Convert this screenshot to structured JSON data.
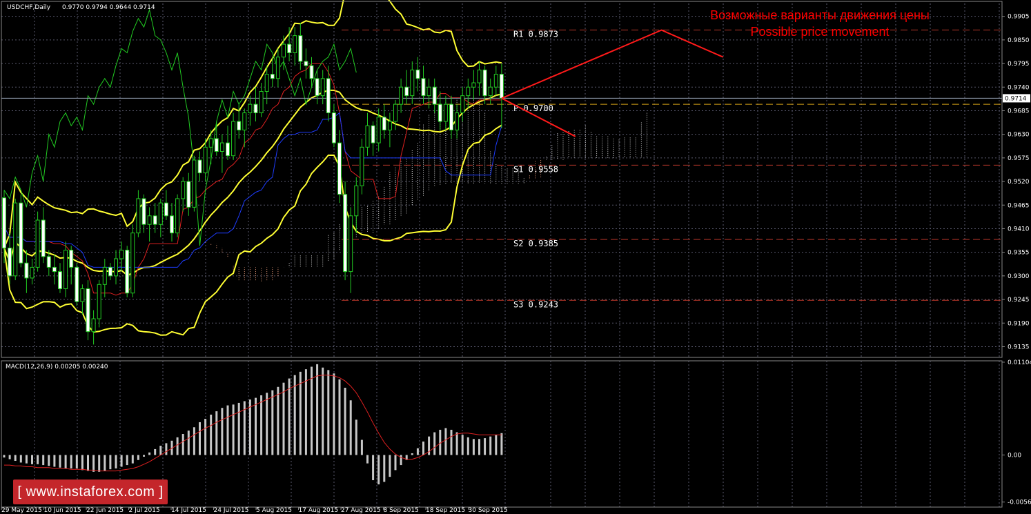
{
  "chart_data": [
    {
      "type": "candlestick",
      "title": "USDCHF,Daily",
      "ohlc_header": "0.9770 0.9794 0.9644 0.9714",
      "last_price": "0.9714",
      "ylim": [
        0.911,
        0.9935
      ],
      "price_ticks": [
        "0.9905",
        "0.9850",
        "0.9795",
        "0.9740",
        "0.9685",
        "0.9630",
        "0.9575",
        "0.9520",
        "0.9465",
        "0.9410",
        "0.9355",
        "0.9300",
        "0.9245",
        "0.9190",
        "0.9135"
      ],
      "date_labels": [
        "29 May 2015",
        "10 Jun 2015",
        "22 Jun 2015",
        "2 Jul 2015",
        "14 Jul 2015",
        "24 Jul 2015",
        "5 Aug 2015",
        "17 Aug 2015",
        "27 Aug 2015",
        "8 Sep 2015",
        "18 Sep 2015",
        "30 Sep 2015"
      ],
      "grid": true,
      "levels": [
        {
          "label": "R1 0.9873",
          "value": 0.9873,
          "color": "#c0392b"
        },
        {
          "label": "P 0.9700",
          "value": 0.97,
          "color": "#d4a017"
        },
        {
          "label": "S1 0.9558",
          "value": 0.9558,
          "color": "#c0392b"
        },
        {
          "label": "S2 0.9385",
          "value": 0.9385,
          "color": "#c0392b"
        },
        {
          "label": "S3 0.9243",
          "value": 0.9243,
          "color": "#c0392b"
        }
      ],
      "annotation_ru": "Возможные варианты движения цены",
      "annotation_en": "Possible price movement",
      "scenario_up": [
        [
          0.9714,
          0
        ],
        [
          0.9873,
          13
        ],
        [
          0.981,
          18
        ]
      ],
      "scenario_down": [
        [
          0.9714,
          0
        ],
        [
          0.9625,
          6
        ]
      ],
      "candles": [
        [
          0.9482,
          0.95,
          0.933,
          0.9365
        ],
        [
          0.9365,
          0.94,
          0.928,
          0.93
        ],
        [
          0.93,
          0.948,
          0.929,
          0.947
        ],
        [
          0.947,
          0.949,
          0.932,
          0.933
        ],
        [
          0.933,
          0.936,
          0.926,
          0.9295
        ],
        [
          0.9295,
          0.934,
          0.928,
          0.932
        ],
        [
          0.932,
          0.945,
          0.931,
          0.943
        ],
        [
          0.943,
          0.946,
          0.933,
          0.9345
        ],
        [
          0.9345,
          0.936,
          0.93,
          0.932
        ],
        [
          0.932,
          0.935,
          0.928,
          0.931
        ],
        [
          0.931,
          0.933,
          0.926,
          0.927
        ],
        [
          0.927,
          0.938,
          0.925,
          0.936
        ],
        [
          0.936,
          0.937,
          0.928,
          0.932
        ],
        [
          0.932,
          0.933,
          0.923,
          0.924
        ],
        [
          0.924,
          0.928,
          0.921,
          0.927
        ],
        [
          0.927,
          0.929,
          0.915,
          0.917
        ],
        [
          0.917,
          0.922,
          0.914,
          0.92
        ],
        [
          0.92,
          0.929,
          0.918,
          0.928
        ],
        [
          0.928,
          0.934,
          0.925,
          0.932
        ],
        [
          0.932,
          0.933,
          0.929,
          0.93
        ],
        [
          0.93,
          0.936,
          0.928,
          0.934
        ],
        [
          0.934,
          0.938,
          0.931,
          0.936
        ],
        [
          0.936,
          0.937,
          0.925,
          0.926
        ],
        [
          0.926,
          0.942,
          0.925,
          0.94
        ],
        [
          0.94,
          0.95,
          0.939,
          0.948
        ],
        [
          0.948,
          0.949,
          0.94,
          0.942
        ],
        [
          0.942,
          0.946,
          0.938,
          0.944
        ],
        [
          0.944,
          0.947,
          0.94,
          0.942
        ],
        [
          0.942,
          0.948,
          0.939,
          0.947
        ],
        [
          0.947,
          0.95,
          0.943,
          0.944
        ],
        [
          0.944,
          0.947,
          0.938,
          0.94
        ],
        [
          0.94,
          0.949,
          0.939,
          0.948
        ],
        [
          0.948,
          0.953,
          0.945,
          0.952
        ],
        [
          0.952,
          0.954,
          0.944,
          0.946
        ],
        [
          0.946,
          0.958,
          0.945,
          0.957
        ],
        [
          0.957,
          0.959,
          0.952,
          0.954
        ],
        [
          0.954,
          0.962,
          0.952,
          0.96
        ],
        [
          0.96,
          0.964,
          0.956,
          0.962
        ],
        [
          0.962,
          0.966,
          0.958,
          0.959
        ],
        [
          0.959,
          0.963,
          0.954,
          0.961
        ],
        [
          0.961,
          0.965,
          0.957,
          0.958
        ],
        [
          0.958,
          0.968,
          0.957,
          0.966
        ],
        [
          0.966,
          0.97,
          0.962,
          0.964
        ],
        [
          0.964,
          0.969,
          0.96,
          0.968
        ],
        [
          0.968,
          0.972,
          0.965,
          0.97
        ],
        [
          0.97,
          0.974,
          0.966,
          0.968
        ],
        [
          0.968,
          0.975,
          0.967,
          0.973
        ],
        [
          0.973,
          0.979,
          0.97,
          0.977
        ],
        [
          0.977,
          0.981,
          0.974,
          0.976
        ],
        [
          0.976,
          0.983,
          0.974,
          0.981
        ],
        [
          0.981,
          0.986,
          0.978,
          0.984
        ],
        [
          0.984,
          0.988,
          0.98,
          0.982
        ],
        [
          0.982,
          0.988,
          0.979,
          0.986
        ],
        [
          0.986,
          0.989,
          0.978,
          0.98
        ],
        [
          0.98,
          0.983,
          0.976,
          0.979
        ],
        [
          0.979,
          0.981,
          0.974,
          0.976
        ],
        [
          0.976,
          0.978,
          0.97,
          0.972
        ],
        [
          0.972,
          0.978,
          0.97,
          0.976
        ],
        [
          0.976,
          0.979,
          0.966,
          0.968
        ],
        [
          0.968,
          0.97,
          0.96,
          0.961
        ],
        [
          0.961,
          0.964,
          0.947,
          0.949
        ],
        [
          0.949,
          0.952,
          0.929,
          0.931
        ],
        [
          0.931,
          0.946,
          0.926,
          0.944
        ],
        [
          0.944,
          0.953,
          0.94,
          0.951
        ],
        [
          0.951,
          0.962,
          0.949,
          0.96
        ],
        [
          0.96,
          0.968,
          0.958,
          0.965
        ],
        [
          0.965,
          0.966,
          0.958,
          0.961
        ],
        [
          0.961,
          0.969,
          0.959,
          0.967
        ],
        [
          0.967,
          0.97,
          0.962,
          0.964
        ],
        [
          0.964,
          0.968,
          0.96,
          0.966
        ],
        [
          0.966,
          0.971,
          0.964,
          0.97
        ],
        [
          0.97,
          0.976,
          0.968,
          0.974
        ],
        [
          0.974,
          0.978,
          0.97,
          0.972
        ],
        [
          0.972,
          0.98,
          0.97,
          0.978
        ],
        [
          0.978,
          0.981,
          0.973,
          0.976
        ],
        [
          0.976,
          0.979,
          0.97,
          0.972
        ],
        [
          0.972,
          0.976,
          0.969,
          0.974
        ],
        [
          0.974,
          0.976,
          0.968,
          0.97
        ],
        [
          0.97,
          0.973,
          0.964,
          0.966
        ],
        [
          0.966,
          0.972,
          0.964,
          0.97
        ],
        [
          0.97,
          0.972,
          0.962,
          0.964
        ],
        [
          0.964,
          0.97,
          0.962,
          0.968
        ],
        [
          0.968,
          0.974,
          0.966,
          0.972
        ],
        [
          0.972,
          0.976,
          0.969,
          0.974
        ],
        [
          0.974,
          0.978,
          0.971,
          0.975
        ],
        [
          0.975,
          0.98,
          0.972,
          0.978
        ],
        [
          0.978,
          0.979,
          0.97,
          0.972
        ],
        [
          0.972,
          0.976,
          0.97,
          0.974
        ],
        [
          0.974,
          0.979,
          0.972,
          0.977
        ],
        [
          0.977,
          0.9794,
          0.9644,
          0.9714
        ]
      ]
    },
    {
      "type": "bar",
      "title": "MACD(12,26,9) 0.00205 0.00240",
      "ylim": [
        -0.0062,
        0.0112
      ],
      "ticks": [
        "0.01104",
        "0.00",
        "-0.0056"
      ],
      "histogram": [
        -0.0003,
        -0.0005,
        -0.0007,
        -0.0009,
        -0.001,
        -0.0011,
        -0.0011,
        -0.0012,
        -0.0013,
        -0.0014,
        -0.0015,
        -0.0016,
        -0.0016,
        -0.0016,
        -0.0018,
        -0.0019,
        -0.002,
        -0.002,
        -0.0019,
        -0.0017,
        -0.0016,
        -0.0014,
        -0.0012,
        -0.001,
        -0.0006,
        -0.0002,
        0.0003,
        0.0007,
        0.0011,
        0.0014,
        0.0017,
        0.0021,
        0.0025,
        0.0029,
        0.0033,
        0.0039,
        0.0043,
        0.0048,
        0.0052,
        0.0056,
        0.0059,
        0.006,
        0.0062,
        0.0064,
        0.0066,
        0.0068,
        0.0071,
        0.0074,
        0.0077,
        0.0081,
        0.0086,
        0.0091,
        0.0095,
        0.0099,
        0.0102,
        0.0105,
        0.0108,
        0.0104,
        0.0101,
        0.0097,
        0.009,
        0.008,
        0.0065,
        0.0042,
        0.0018,
        -0.001,
        -0.003,
        -0.0035,
        -0.0032,
        -0.0026,
        -0.0018,
        -0.0012,
        -0.0006,
        0.0002,
        0.0008,
        0.0016,
        0.0022,
        0.0027,
        0.003,
        0.0032,
        0.003,
        0.0027,
        0.0024,
        0.0021,
        0.0019,
        0.0019,
        0.002,
        0.0022,
        0.0024,
        0.0026
      ],
      "signal": [
        -0.0012,
        -0.0012,
        -0.0013,
        -0.0013,
        -0.0014,
        -0.0014,
        -0.0015,
        -0.0015,
        -0.0015,
        -0.0016,
        -0.0016,
        -0.0016,
        -0.0017,
        -0.0017,
        -0.0017,
        -0.0018,
        -0.0018,
        -0.0019,
        -0.0019,
        -0.0019,
        -0.0019,
        -0.0018,
        -0.0017,
        -0.0016,
        -0.0014,
        -0.0011,
        -0.0008,
        -0.0004,
        0.0,
        0.0004,
        0.0008,
        0.0012,
        0.0016,
        0.002,
        0.0024,
        0.0028,
        0.0032,
        0.0035,
        0.0039,
        0.0042,
        0.0045,
        0.0048,
        0.0051,
        0.0054,
        0.0057,
        0.006,
        0.0063,
        0.0066,
        0.0069,
        0.0072,
        0.0075,
        0.0079,
        0.0082,
        0.0085,
        0.0088,
        0.0091,
        0.0094,
        0.0095,
        0.0095,
        0.0094,
        0.0092,
        0.0088,
        0.0082,
        0.0074,
        0.0063,
        0.0051,
        0.0038,
        0.0026,
        0.0015,
        0.0007,
        0.0001,
        -0.0003,
        -0.0005,
        -0.0005,
        -0.0003,
        0.0,
        0.0004,
        0.0009,
        0.0014,
        0.0018,
        0.0022,
        0.0025,
        0.0026,
        0.0026,
        0.0025,
        0.0024,
        0.0024,
        0.0024,
        0.0024,
        0.0024
      ]
    }
  ],
  "branding": {
    "site": "[ www.instaforex.com ]",
    "badge_color": "#c4262b"
  }
}
